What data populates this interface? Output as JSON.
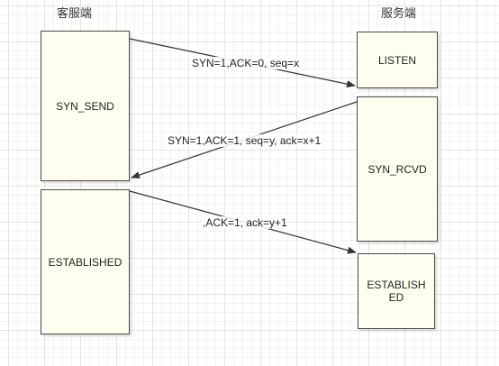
{
  "headers": {
    "client": "客服端",
    "server": "服务端"
  },
  "states": {
    "client_syn_send": "SYN_SEND",
    "client_established": "ESTABLISHED",
    "server_listen": "LISTEN",
    "server_syn_rcvd": "SYN_RCVD",
    "server_established": "ESTABLISHED"
  },
  "messages": [
    "SYN=1,ACK=0, seq=x",
    "SYN=1,ACK=1, seq=y, ack=x+1",
    ",ACK=1, ack=y+1"
  ],
  "colors": {
    "box_fill": "#fffff0",
    "box_border": "#4a4a4a",
    "arrow": "#333333"
  }
}
